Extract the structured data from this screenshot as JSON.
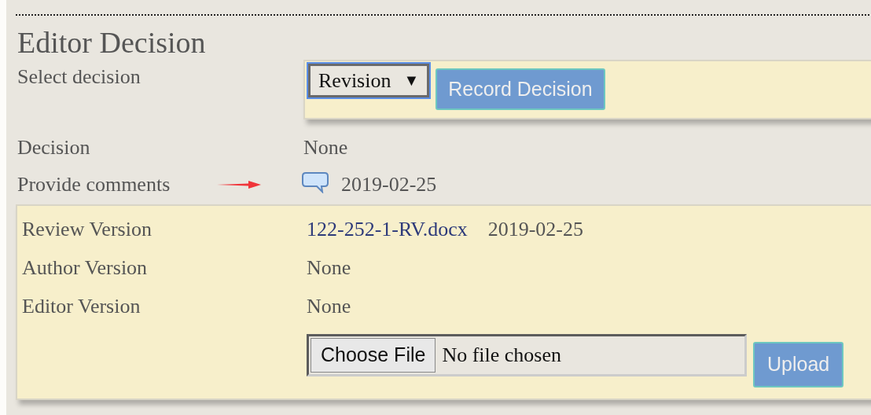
{
  "section": {
    "title": "Editor Decision"
  },
  "select_decision": {
    "label": "Select decision",
    "value": "Revision",
    "caret": "▼",
    "button": "Record Decision"
  },
  "decision": {
    "label": "Decision",
    "value": "None"
  },
  "comments": {
    "label": "Provide comments",
    "date": "2019-02-25"
  },
  "versions": [
    {
      "label": "Review Version",
      "file": "122-252-1-RV.docx",
      "date": "2019-02-25"
    },
    {
      "label": "Author Version",
      "value": "None"
    },
    {
      "label": "Editor Version",
      "value": "None"
    }
  ],
  "upload": {
    "choose_button": "Choose File",
    "status": "No file chosen",
    "upload_button": "Upload"
  }
}
